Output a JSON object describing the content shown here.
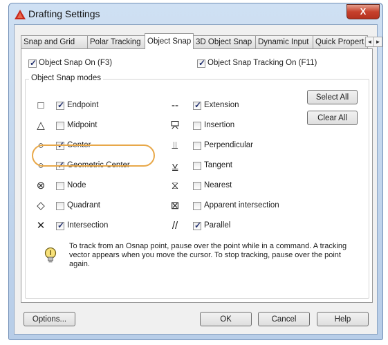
{
  "window": {
    "title": "Drafting Settings",
    "close_glyph": "X"
  },
  "tabs": [
    "Snap and Grid",
    "Polar Tracking",
    "Object Snap",
    "3D Object Snap",
    "Dynamic Input",
    "Quick Propert"
  ],
  "active_tab": "Object Snap",
  "scroll": {
    "left": "◄",
    "right": "►"
  },
  "osnap_on": {
    "label": "Object Snap On (F3)",
    "checked": true
  },
  "tracking_on": {
    "label": "Object Snap Tracking On (F11)",
    "checked": true
  },
  "modes_group": {
    "label": "Object Snap modes"
  },
  "modes_left": [
    {
      "symbol": "□",
      "label": "Endpoint",
      "checked": true
    },
    {
      "symbol": "△",
      "label": "Midpoint",
      "checked": false
    },
    {
      "symbol": "○",
      "label": "Center",
      "checked": true
    },
    {
      "symbol": "○",
      "label": "Geometric Center",
      "checked": true
    },
    {
      "symbol": "⊗",
      "label": "Node",
      "checked": false
    },
    {
      "symbol": "◇",
      "label": "Quadrant",
      "checked": false
    },
    {
      "symbol": "✕",
      "label": "Intersection",
      "checked": true
    }
  ],
  "modes_right": [
    {
      "symbol": "--",
      "label": "Extension",
      "checked": true
    },
    {
      "symbol": "⯳",
      "label": "Insertion",
      "checked": false
    },
    {
      "symbol": "⫫",
      "label": "Perpendicular",
      "checked": false
    },
    {
      "symbol": "⩣",
      "label": "Tangent",
      "checked": false
    },
    {
      "symbol": "⧖",
      "label": "Nearest",
      "checked": false
    },
    {
      "symbol": "⊠",
      "label": "Apparent intersection",
      "checked": false
    },
    {
      "symbol": "//",
      "label": "Parallel",
      "checked": true
    }
  ],
  "buttons": {
    "select_all": "Select All",
    "clear_all": "Clear All",
    "options": "Options...",
    "ok": "OK",
    "cancel": "Cancel",
    "help": "Help"
  },
  "tip": "To track from an Osnap point, pause over the point while in a command. A tracking vector appears when you move the cursor. To stop tracking, pause over the point again.",
  "colors": {
    "highlight": "#e8a849",
    "title_gradient": "#cfe0f3",
    "close": "#c6412c"
  }
}
